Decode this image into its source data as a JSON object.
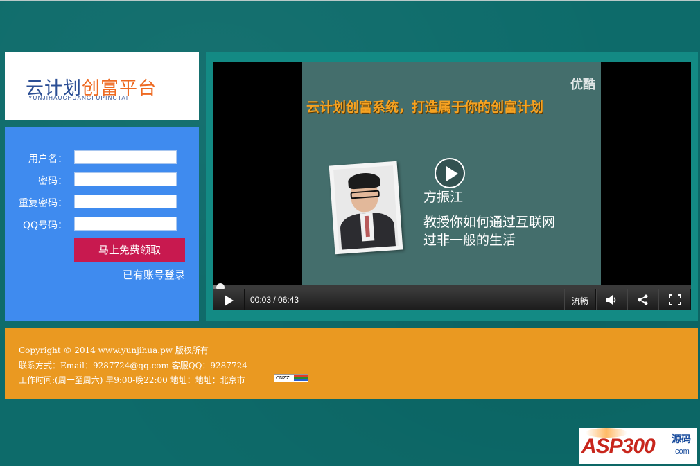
{
  "logo": {
    "part1": "云计划",
    "part2": "创富平台",
    "subtitle": "YUNJIHAUCHUANGFUPINGTAI"
  },
  "form": {
    "username_label": "用户名：",
    "password_label": "密码：",
    "confirm_label": "重复密码：",
    "qq_label": "QQ号码：",
    "username_value": "",
    "password_value": "",
    "confirm_value": "",
    "qq_value": "",
    "submit_label": "马上免费领取",
    "login_link": "已有账号登录"
  },
  "video": {
    "watermark": "优酷",
    "headline": "云计划创富系统，打造属于你的创富计划",
    "speaker_name": "方振江",
    "speaker_desc_1": "教授你如何通过互联网",
    "speaker_desc_2": "过非一般的生活",
    "current_time": "00:03",
    "duration": "06:43",
    "time_display": "00:03 / 06:43",
    "progress_fraction": 0.0074,
    "quality_label": "流畅",
    "icons": [
      "play-icon",
      "volume-icon",
      "share-icon",
      "fullscreen-icon"
    ]
  },
  "footer": {
    "copyright": "Copyright © 2014 www.yunjihua.pw 版权所有",
    "contact": "联系方式：Email：9287724@qq.com 客服QQ：9287724",
    "hours": "工作时间:(周一至周六) 早9:00-晚22:00 地址：地址：北京市",
    "stat_badge": "CNZZ"
  },
  "watermark": {
    "brand": "ASP300",
    "yuanma": "源码",
    "domain": ".com"
  },
  "colors": {
    "background": "#0d6b6a",
    "form_panel": "#3f8bef",
    "video_panel": "#138a84",
    "submit_button": "#c8194f",
    "footer": "#ea9921",
    "logo_blue": "#2c4f95",
    "logo_orange": "#ee6a22"
  }
}
